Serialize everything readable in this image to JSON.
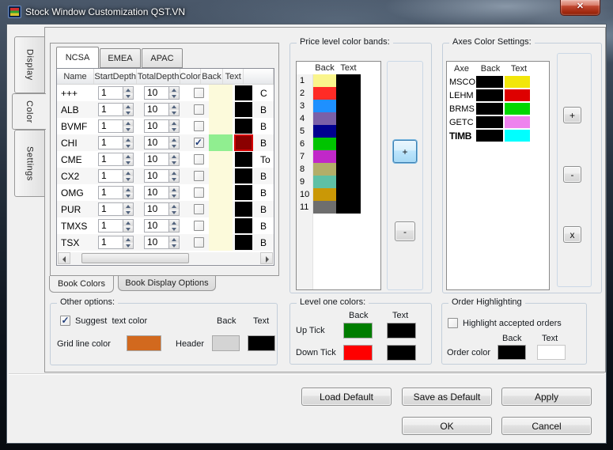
{
  "window": {
    "title": "Stock Window Customization QST.VN",
    "close": "✕"
  },
  "side_tabs": {
    "display": "Display",
    "color": "Color",
    "settings": "Settings"
  },
  "book": {
    "region_tabs": {
      "ncsa": "NCSA",
      "emea": "EMEA",
      "apac": "APAC"
    },
    "table": {
      "headers": {
        "name": "Name",
        "start": "StartDepth",
        "total": "TotalDepth",
        "color": "Color",
        "back": "Back",
        "text": "Text"
      },
      "rows": [
        {
          "name": "+++",
          "start": "1",
          "total": "10",
          "checked": false,
          "back": "#FCFADB",
          "text": "#000000",
          "more": "C"
        },
        {
          "name": "ALB",
          "start": "1",
          "total": "10",
          "checked": false,
          "back": "#FCFADB",
          "text": "#000000",
          "more": "B"
        },
        {
          "name": "BVMF",
          "start": "1",
          "total": "10",
          "checked": false,
          "back": "#FCFADB",
          "text": "#000000",
          "more": "B"
        },
        {
          "name": "CHI",
          "start": "1",
          "total": "10",
          "checked": true,
          "back": "#90EE90",
          "text": "#8B0000",
          "selected": true,
          "more": "B"
        },
        {
          "name": "CME",
          "start": "1",
          "total": "10",
          "checked": false,
          "back": "#FCFADB",
          "text": "#000000",
          "more": "To"
        },
        {
          "name": "CX2",
          "start": "1",
          "total": "10",
          "checked": false,
          "back": "#FCFADB",
          "text": "#000000",
          "more": "B"
        },
        {
          "name": "OMG",
          "start": "1",
          "total": "10",
          "checked": false,
          "back": "#FCFADB",
          "text": "#000000",
          "more": "B"
        },
        {
          "name": "PUR",
          "start": "1",
          "total": "10",
          "checked": false,
          "back": "#FCFADB",
          "text": "#000000",
          "more": "B"
        },
        {
          "name": "TMXS",
          "start": "1",
          "total": "10",
          "checked": false,
          "back": "#FCFADB",
          "text": "#000000",
          "more": "B"
        },
        {
          "name": "TSX",
          "start": "1",
          "total": "10",
          "checked": false,
          "back": "#FCFADB",
          "text": "#000000",
          "more": "B"
        }
      ]
    },
    "bottom_tabs": {
      "colors": "Book Colors",
      "display_options": "Book Display Options"
    }
  },
  "price_bands": {
    "title": "Price level color bands:",
    "headers": {
      "back": "Back",
      "text": "Text"
    },
    "rows": [
      {
        "num": "1",
        "back": "#FAF58C",
        "text": "#000000"
      },
      {
        "num": "2",
        "back": "#FF2B26",
        "text": "#000000"
      },
      {
        "num": "3",
        "back": "#1E90FF",
        "text": "#000000"
      },
      {
        "num": "4",
        "back": "#7A60A8",
        "text": "#000000"
      },
      {
        "num": "5",
        "back": "#00008F",
        "text": "#000000"
      },
      {
        "num": "6",
        "back": "#00C400",
        "text": "#000000"
      },
      {
        "num": "7",
        "back": "#C128C9",
        "text": "#000000"
      },
      {
        "num": "8",
        "back": "#B2AE69",
        "text": "#000000"
      },
      {
        "num": "9",
        "back": "#5EC0A5",
        "text": "#000000"
      },
      {
        "num": "10",
        "back": "#CA9806",
        "text": "#000000"
      },
      {
        "num": "11",
        "back": "#6E6E6E",
        "text": "#000000"
      }
    ],
    "add_button": "+",
    "remove_button": "-"
  },
  "axes": {
    "title": "Axes Color Settings:",
    "headers": {
      "axe": "Axe",
      "back": "Back",
      "text": "Text"
    },
    "rows": [
      {
        "name": "MSCO",
        "back": "#000000",
        "text": "#F2E60A"
      },
      {
        "name": "LEHM",
        "back": "#000000",
        "text": "#DE0000"
      },
      {
        "name": "BRMS",
        "back": "#000000",
        "text": "#00D800"
      },
      {
        "name": "GETC",
        "back": "#000000",
        "text": "#EE82EE"
      },
      {
        "name": "TIMB",
        "back": "#000000",
        "text": "#00FFFF",
        "bold": true
      }
    ],
    "add_button": "+",
    "remove_button": "-",
    "delete_button": "x"
  },
  "other_options": {
    "title": "Other options:",
    "suggest_label": "Suggest  text color",
    "suggest_checked": true,
    "back_header": "Back",
    "text_header": "Text",
    "grid_line_label": "Grid line color",
    "grid_line_color": "#D2691E",
    "header_label": "Header",
    "header_back": "#D4D4D4",
    "header_text": "#000000"
  },
  "level_one": {
    "title": "Level one colors:",
    "back_header": "Back",
    "text_header": "Text",
    "rows": [
      {
        "label": "Up Tick",
        "back": "#007D00",
        "text": "#000000"
      },
      {
        "label": "Down Tick",
        "back": "#FF0000",
        "text": "#000000"
      }
    ]
  },
  "order_highlighting": {
    "title": "Order Highlighting",
    "highlight_label": "Highlight accepted orders",
    "highlight_checked": false,
    "back_header": "Back",
    "text_header": "Text",
    "order_color_label": "Order color",
    "order_back": "#000000",
    "order_text": "#FFFFFF"
  },
  "footer": {
    "load_default": "Load Default",
    "save_as_default": "Save as Default",
    "apply": "Apply",
    "ok": "OK",
    "cancel": "Cancel"
  }
}
